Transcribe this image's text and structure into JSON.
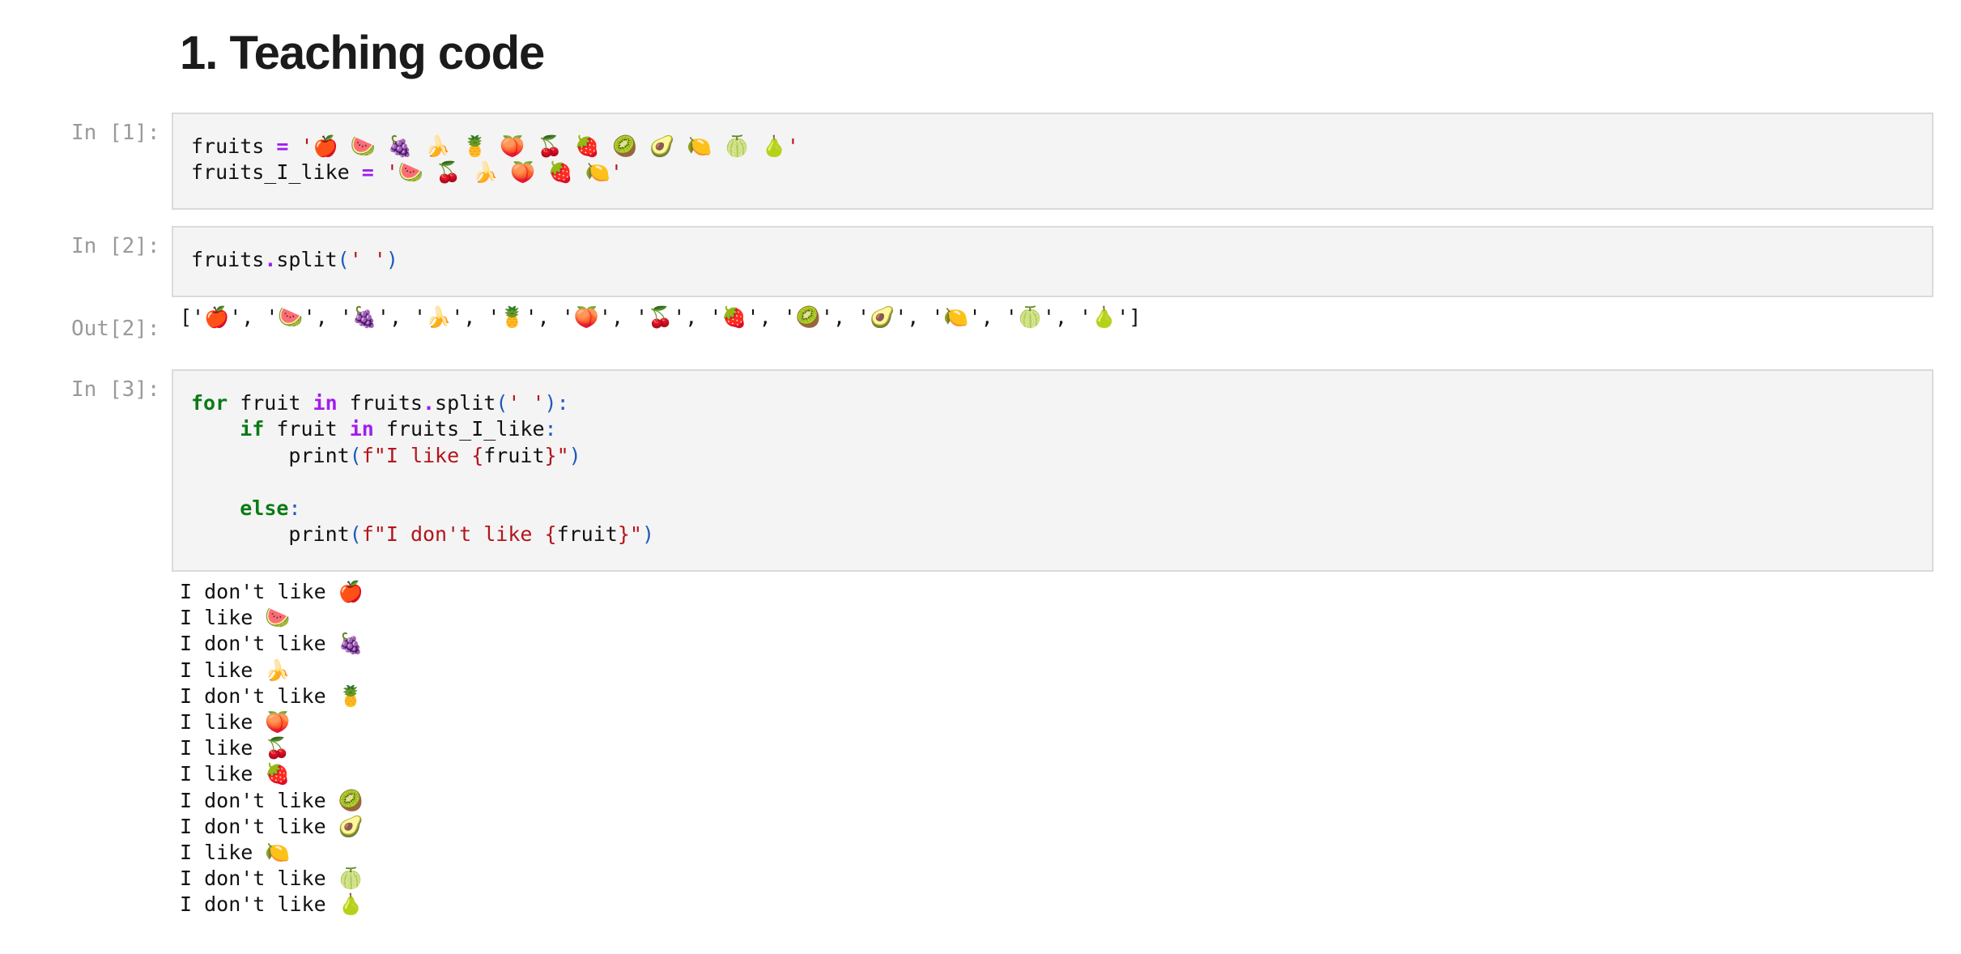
{
  "heading": "1. Teaching code",
  "cells": [
    {
      "prompt": "In [1]:",
      "code": [
        [
          {
            "t": "fruits ",
            "c": ""
          },
          {
            "t": "=",
            "c": "op"
          },
          {
            "t": " ",
            "c": ""
          },
          {
            "t": "'🍎 🍉 🍇 🍌 🍍 🍑 🍒 🍓 🥝 🥑 🍋 🍈 🍐'",
            "c": "str"
          }
        ],
        [
          {
            "t": "fruits_I_like ",
            "c": ""
          },
          {
            "t": "=",
            "c": "op"
          },
          {
            "t": " ",
            "c": ""
          },
          {
            "t": "'🍉 🍒 🍌 🍑 🍓 🍋'",
            "c": "str"
          }
        ]
      ]
    },
    {
      "prompt": "In [2]:",
      "code": [
        [
          {
            "t": "fruits",
            "c": ""
          },
          {
            "t": ".",
            "c": "op"
          },
          {
            "t": "split",
            "c": ""
          },
          {
            "t": "(",
            "c": "par"
          },
          {
            "t": "' '",
            "c": "str"
          },
          {
            "t": ")",
            "c": "par"
          }
        ]
      ]
    },
    {
      "prompt": "In [3]:",
      "code": [
        [
          {
            "t": "for",
            "c": "kw"
          },
          {
            "t": " fruit ",
            "c": ""
          },
          {
            "t": "in",
            "c": "op"
          },
          {
            "t": " fruits",
            "c": ""
          },
          {
            "t": ".",
            "c": "op"
          },
          {
            "t": "split",
            "c": ""
          },
          {
            "t": "(",
            "c": "par"
          },
          {
            "t": "' '",
            "c": "str"
          },
          {
            "t": "):",
            "c": "par"
          }
        ],
        [
          {
            "t": "    ",
            "c": ""
          },
          {
            "t": "if",
            "c": "kw"
          },
          {
            "t": " fruit ",
            "c": ""
          },
          {
            "t": "in",
            "c": "op"
          },
          {
            "t": " fruits_I_like",
            "c": ""
          },
          {
            "t": ":",
            "c": "par"
          }
        ],
        [
          {
            "t": "        print",
            "c": ""
          },
          {
            "t": "(",
            "c": "par"
          },
          {
            "t": "f\"I like {",
            "c": "str"
          },
          {
            "t": "fruit",
            "c": ""
          },
          {
            "t": "}\"",
            "c": "str"
          },
          {
            "t": ")",
            "c": "par"
          }
        ],
        [],
        [
          {
            "t": "    ",
            "c": ""
          },
          {
            "t": "else",
            "c": "kw"
          },
          {
            "t": ":",
            "c": "par"
          }
        ],
        [
          {
            "t": "        print",
            "c": ""
          },
          {
            "t": "(",
            "c": "par"
          },
          {
            "t": "f\"I don't like {",
            "c": "str"
          },
          {
            "t": "fruit",
            "c": ""
          },
          {
            "t": "}\"",
            "c": "str"
          },
          {
            "t": ")",
            "c": "par"
          }
        ]
      ]
    }
  ],
  "out2_prompt": "Out[2]:",
  "out2_text": "['🍎', '🍉', '🍇', '🍌', '🍍', '🍑', '🍒', '🍓', '🥝', '🥑', '🍋', '🍈', '🍐']",
  "out3_lines": [
    "I don't like 🍎",
    "I like 🍉",
    "I don't like 🍇",
    "I like 🍌",
    "I don't like 🍍",
    "I like 🍑",
    "I like 🍒",
    "I like 🍓",
    "I don't like 🥝",
    "I don't like 🥑",
    "I like 🍋",
    "I don't like 🍈",
    "I don't like 🍐"
  ]
}
